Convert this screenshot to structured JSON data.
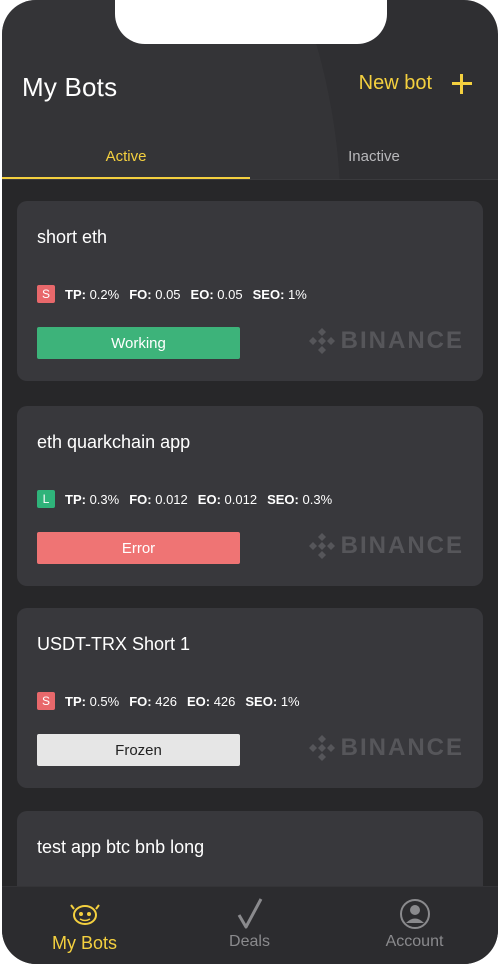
{
  "header": {
    "title": "My Bots",
    "new_bot_label": "New bot"
  },
  "tabs": [
    {
      "label": "Active",
      "active": true
    },
    {
      "label": "Inactive",
      "active": false
    }
  ],
  "bots": [
    {
      "name": "short eth",
      "side": "S",
      "tp": "0.2%",
      "fo": "0.05",
      "eo": "0.05",
      "seo": "1%",
      "status": "Working",
      "exchange": "BINANCE"
    },
    {
      "name": "eth quarkchain app",
      "side": "L",
      "tp": "0.3%",
      "fo": "0.012",
      "eo": "0.012",
      "seo": "0.3%",
      "status": "Error",
      "exchange": "BINANCE"
    },
    {
      "name": "USDT-TRX Short 1",
      "side": "S",
      "tp": "0.5%",
      "fo": "426",
      "eo": "426",
      "seo": "1%",
      "status": "Frozen",
      "exchange": "BINANCE"
    },
    {
      "name": "test app btc bnb long"
    }
  ],
  "labels": {
    "tp": "TP:",
    "fo": "FO:",
    "eo": "EO:",
    "seo": "SEO:"
  },
  "nav": [
    {
      "label": "My Bots",
      "icon": "bot-face-icon",
      "active": true
    },
    {
      "label": "Deals",
      "icon": "checkmark-icon",
      "active": false
    },
    {
      "label": "Account",
      "icon": "user-circle-icon",
      "active": false
    }
  ],
  "colors": {
    "accent": "#f4d03f",
    "working": "#3db37a",
    "error": "#ef7474",
    "frozen": "#e6e6e6",
    "short_badge": "#e8686b",
    "long_badge": "#2fb37a"
  }
}
